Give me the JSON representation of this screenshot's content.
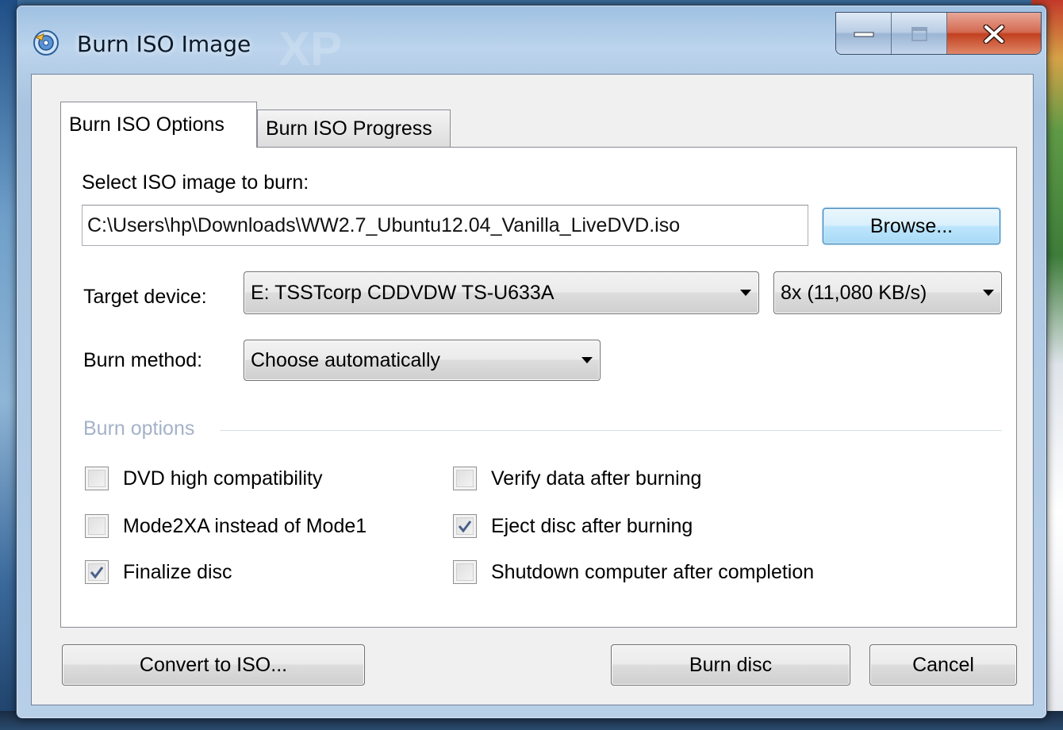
{
  "window": {
    "title": "Burn ISO Image",
    "watermark": "XP"
  },
  "tabs": [
    {
      "label": "Burn ISO Options",
      "active": true
    },
    {
      "label": "Burn ISO Progress",
      "active": false
    }
  ],
  "iso": {
    "select_label": "Select ISO image to burn:",
    "path": "C:\\Users\\hp\\Downloads\\WW2.7_Ubuntu12.04_Vanilla_LiveDVD.iso",
    "browse_label": "Browse..."
  },
  "target": {
    "label": "Target device:",
    "device": "E: TSSTcorp CDDVDW TS-U633A",
    "speed": "8x (11,080 KB/s)"
  },
  "method": {
    "label": "Burn method:",
    "value": "Choose automatically"
  },
  "options": {
    "title": "Burn options",
    "items": [
      {
        "label": "DVD high compatibility",
        "checked": false
      },
      {
        "label": "Mode2XA instead of Mode1",
        "checked": false
      },
      {
        "label": "Finalize disc",
        "checked": true
      },
      {
        "label": "Verify data after burning",
        "checked": false
      },
      {
        "label": "Eject disc after burning",
        "checked": true
      },
      {
        "label": "Shutdown computer after completion",
        "checked": false
      }
    ]
  },
  "buttons": {
    "convert": "Convert to ISO...",
    "burn": "Burn disc",
    "cancel": "Cancel"
  },
  "icons": {
    "app": "disc-burn-icon",
    "minimize": "minimize-icon",
    "maximize": "maximize-icon",
    "close": "close-icon",
    "dropdown": "chevron-down-icon",
    "check": "checkmark-icon"
  }
}
